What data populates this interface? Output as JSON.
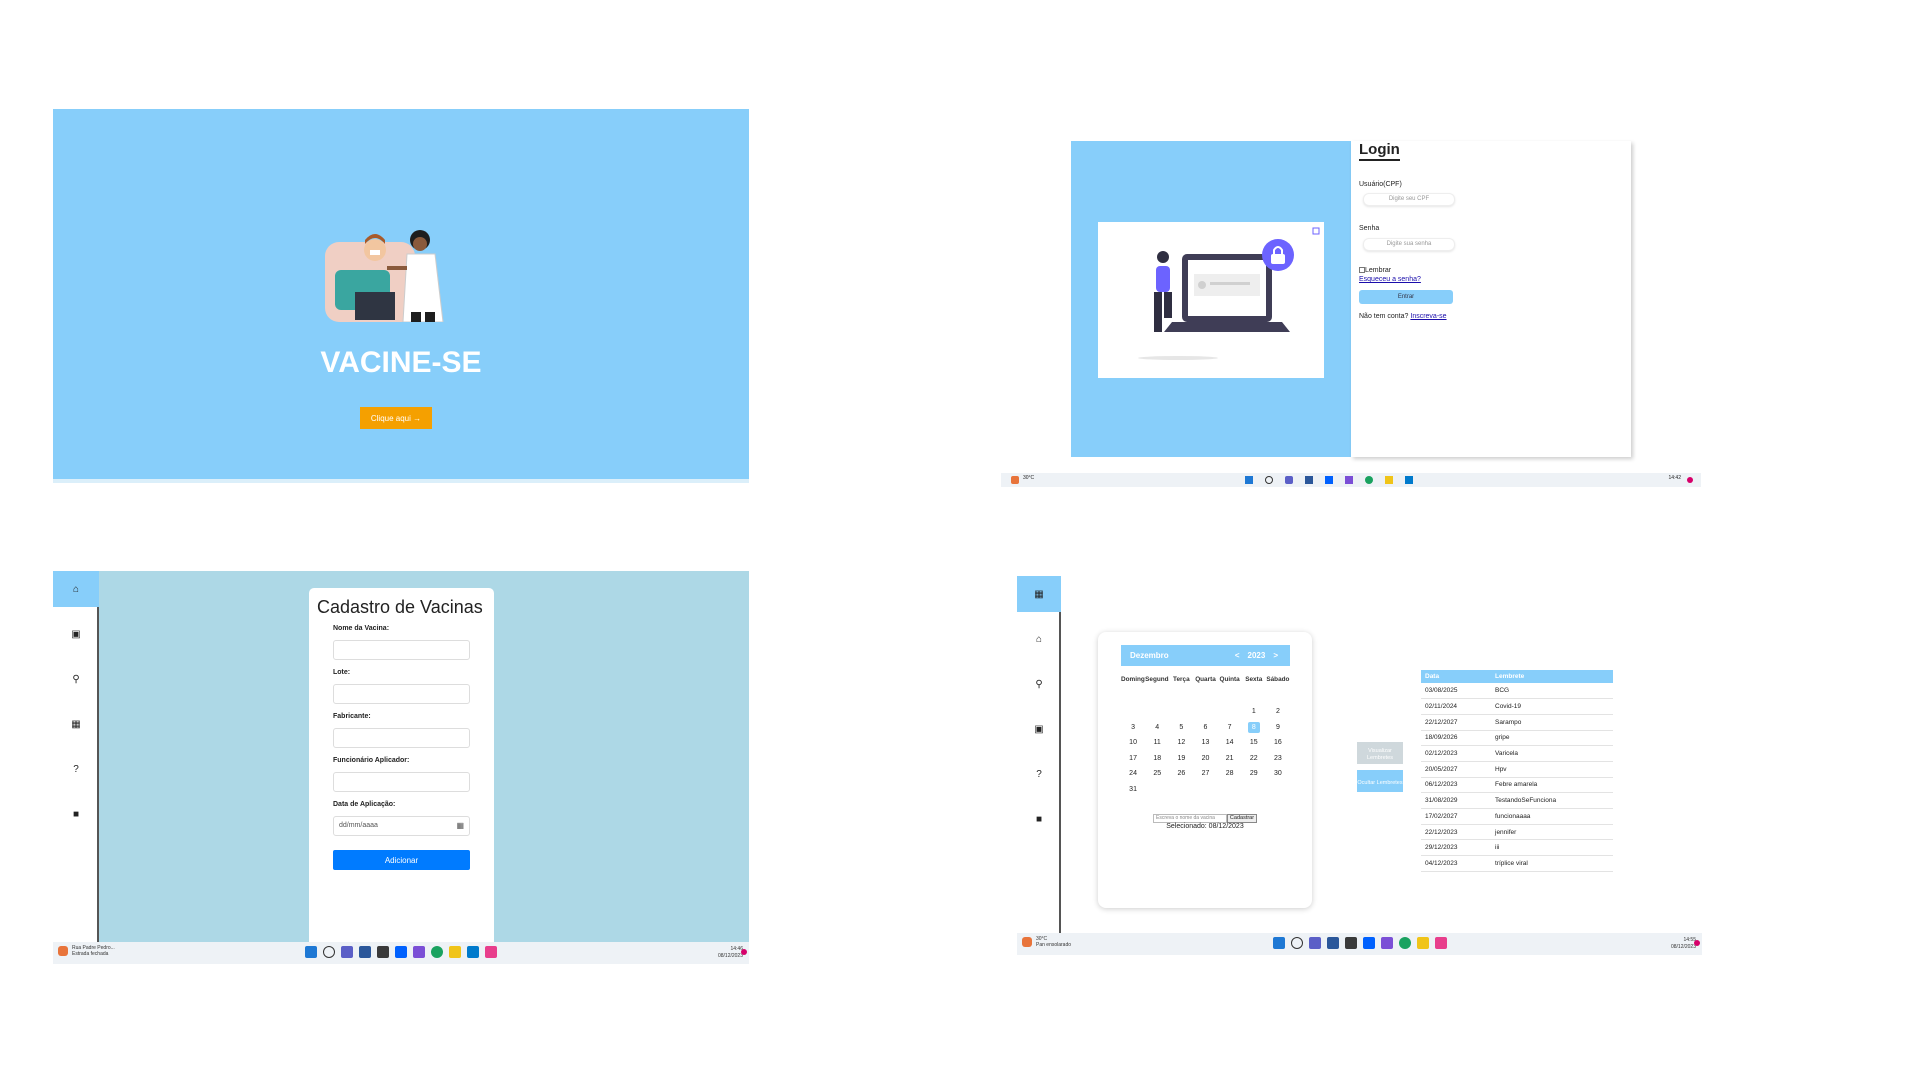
{
  "landing": {
    "title": "VACINE-SE",
    "cta_label": "Clique aqui →"
  },
  "login": {
    "title": "Login",
    "user_label": "Usuário(CPF)",
    "user_placeholder": "Digite seu CPF",
    "password_label": "Senha",
    "password_placeholder": "Digite sua senha",
    "remember_label": "Lembrar",
    "forgot_label": "Esqueceu a senha?",
    "enter_label": "Entrar",
    "no_account_text": "Não tem conta?",
    "signup_label": "Inscreva-se"
  },
  "cadastro": {
    "title": "Cadastro de Vacinas",
    "fields": [
      {
        "label": "Nome da Vacina:",
        "value": ""
      },
      {
        "label": "Lote:",
        "value": ""
      },
      {
        "label": "Fabricante:",
        "value": ""
      },
      {
        "label": "Funcionário Aplicador:",
        "value": ""
      },
      {
        "label": "Data de Aplicação:",
        "value": "dd/mm/aaaa"
      }
    ],
    "add_label": "Adicionar",
    "taskbar": {
      "left_title": "Rua Padre Pedro...",
      "left_sub": "Estrada fechada",
      "time": "14:46",
      "date": "08/12/2023"
    }
  },
  "calendar": {
    "month": "Dezembro",
    "year": "2023",
    "prev": "<",
    "next": ">",
    "weekdays": [
      "Domingo",
      "Segunda",
      "Terça",
      "Quarta",
      "Quinta",
      "Sexta",
      "Sábado"
    ],
    "weeks": [
      [
        "",
        "",
        "",
        "",
        "",
        "1",
        "2"
      ],
      [
        "3",
        "4",
        "5",
        "6",
        "7",
        "8",
        "9"
      ],
      [
        "10",
        "11",
        "12",
        "13",
        "14",
        "15",
        "16"
      ],
      [
        "17",
        "18",
        "19",
        "20",
        "21",
        "22",
        "23"
      ],
      [
        "24",
        "25",
        "26",
        "27",
        "28",
        "29",
        "30"
      ],
      [
        "31",
        "",
        "",
        "",
        "",
        "",
        ""
      ]
    ],
    "selected_day": "8",
    "vaccine_input_placeholder": "Escreva o nome da vacina",
    "register_label": "Cadastrar",
    "selected_text": "Selecionado: 08/12/2023",
    "show_label": "Visualizar Lembretes",
    "hide_label": "Ocultar Lembretes",
    "table_headers": [
      "Data",
      "Lembrete"
    ],
    "reminders": [
      [
        "03/08/2025",
        "BCG"
      ],
      [
        "02/11/2024",
        "Covid-19"
      ],
      [
        "22/12/2027",
        "Sarampo"
      ],
      [
        "18/09/2026",
        "gripe"
      ],
      [
        "02/12/2023",
        "Varicela"
      ],
      [
        "20/05/2027",
        "Hpv"
      ],
      [
        "06/12/2023",
        "Febre amarela"
      ],
      [
        "31/08/2029",
        "TestandoSeFunciona"
      ],
      [
        "17/02/2027",
        "funcionaaaa"
      ],
      [
        "22/12/2023",
        "jennifer"
      ],
      [
        "29/12/2023",
        "iii"
      ],
      [
        "04/12/2023",
        "tríplice viral"
      ]
    ],
    "taskbar": {
      "weather": "30°C",
      "weather_sub": "Pan ensolarado",
      "time": "14:55",
      "date": "08/12/2023"
    }
  },
  "login_taskbar": {
    "weather": "30°C",
    "time": "14:42"
  },
  "colors": {
    "sky": "#87cefa",
    "lightblue": "#add8e6",
    "orange": "#f5a000",
    "primary": "#007bff"
  }
}
